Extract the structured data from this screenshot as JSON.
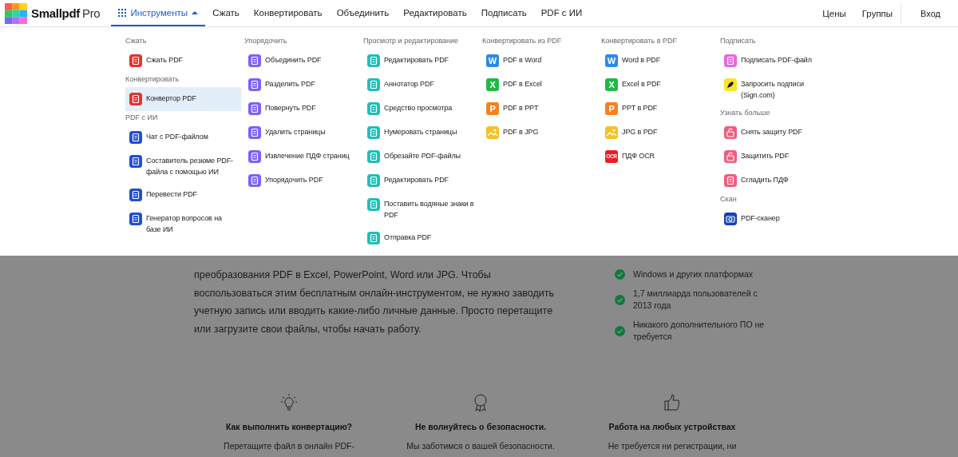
{
  "header": {
    "logo": {
      "name": "Smallpdf",
      "suffix": "Pro"
    },
    "nav": [
      {
        "label": "Инструменты",
        "selected": true,
        "kind": "menu"
      },
      {
        "label": "Сжать",
        "selected": false,
        "kind": "link"
      },
      {
        "label": "Конвертировать",
        "selected": false,
        "kind": "link"
      },
      {
        "label": "Объединить",
        "selected": false,
        "kind": "link"
      },
      {
        "label": "Редактировать",
        "selected": false,
        "kind": "link"
      },
      {
        "label": "Подписать",
        "selected": false,
        "kind": "link"
      },
      {
        "label": "PDF с ИИ",
        "selected": false,
        "kind": "link"
      }
    ],
    "right": [
      "Цены",
      "Группы"
    ],
    "login": "Вход"
  },
  "menu": {
    "columns": [
      {
        "groups": [
          {
            "heading": "Сжать",
            "items": [
              {
                "label": "Сжать PDF",
                "color": "#e5322d",
                "kind": "doc",
                "selected": false
              }
            ]
          },
          {
            "heading": "Конвертировать",
            "items": [
              {
                "label": "Конвертор PDF",
                "color": "#e5322d",
                "kind": "doc",
                "selected": true
              }
            ]
          },
          {
            "heading": "PDF с ИИ",
            "items": [
              {
                "label": "Чат с PDF-файлом",
                "color": "#1f4fd6",
                "kind": "doc",
                "selected": false
              },
              {
                "label": "Составитель резюме PDF-файла с помощью ИИ",
                "color": "#1f4fd6",
                "kind": "doc",
                "selected": false
              },
              {
                "label": "Перевести PDF",
                "color": "#1f4fd6",
                "kind": "doc",
                "selected": false
              },
              {
                "label": "Генератор вопросов на базе ИИ",
                "color": "#1f4fd6",
                "kind": "doc",
                "selected": false
              }
            ]
          }
        ]
      },
      {
        "groups": [
          {
            "heading": "Упорядочить",
            "items": [
              {
                "label": "Объединить PDF",
                "color": "#7b61ff",
                "kind": "doc",
                "selected": false
              },
              {
                "label": "Разделить PDF",
                "color": "#7b61ff",
                "kind": "doc",
                "selected": false
              },
              {
                "label": "Повернуть PDF",
                "color": "#7b61ff",
                "kind": "doc",
                "selected": false
              },
              {
                "label": "Удалить страницы",
                "color": "#7b61ff",
                "kind": "doc",
                "selected": false
              },
              {
                "label": "Извлечение ПДФ страниц",
                "color": "#7b61ff",
                "kind": "doc",
                "selected": false
              },
              {
                "label": "Упорядочить PDF",
                "color": "#7b61ff",
                "kind": "doc",
                "selected": false
              }
            ]
          }
        ]
      },
      {
        "groups": [
          {
            "heading": "Просмотр и редактирование",
            "items": [
              {
                "label": "Редактировать PDF",
                "color": "#1fbfb8",
                "kind": "doc",
                "selected": false
              },
              {
                "label": "Аннотатор PDF",
                "color": "#1fbfb8",
                "kind": "doc",
                "selected": false
              },
              {
                "label": "Средство просмотра",
                "color": "#1fbfb8",
                "kind": "doc",
                "selected": false
              },
              {
                "label": "Нумеровать страницы",
                "color": "#1fbfb8",
                "kind": "doc",
                "selected": false
              },
              {
                "label": "Обрезайте PDF-файлы",
                "color": "#1fbfb8",
                "kind": "doc",
                "selected": false
              },
              {
                "label": "Редактировать PDF",
                "color": "#1fbfb8",
                "kind": "doc",
                "selected": false
              },
              {
                "label": "Поставить водяные знаки в PDF",
                "color": "#1fbfb8",
                "kind": "doc",
                "selected": false
              },
              {
                "label": "Отправка PDF",
                "color": "#1fbfb8",
                "kind": "doc",
                "selected": false
              }
            ]
          }
        ]
      },
      {
        "groups": [
          {
            "heading": "Конвертировать из PDF",
            "items": [
              {
                "label": "PDF в Word",
                "color": "#2b8ae6",
                "kind": "letter",
                "glyph": "W",
                "selected": false
              },
              {
                "label": "PDF в Excel",
                "color": "#1fb84a",
                "kind": "letter",
                "glyph": "X",
                "selected": false
              },
              {
                "label": "PDF в PPT",
                "color": "#f5811f",
                "kind": "letter",
                "glyph": "P",
                "selected": false
              },
              {
                "label": "PDF в JPG",
                "color": "#f6c026",
                "kind": "image",
                "selected": false
              }
            ]
          }
        ]
      },
      {
        "groups": [
          {
            "heading": "Конвертировать в PDF",
            "items": [
              {
                "label": "Word в PDF",
                "color": "#2b8ae6",
                "kind": "letter",
                "glyph": "W",
                "selected": false
              },
              {
                "label": "Excel в PDF",
                "color": "#1fb84a",
                "kind": "letter",
                "glyph": "X",
                "selected": false
              },
              {
                "label": "PPT в PDF",
                "color": "#f5811f",
                "kind": "letter",
                "glyph": "P",
                "selected": false
              },
              {
                "label": "JPG в PDF",
                "color": "#f6c026",
                "kind": "image",
                "selected": false
              },
              {
                "label": "ПДФ OCR",
                "color": "#ec1c24",
                "kind": "letter",
                "glyph": "OCR",
                "selected": false
              }
            ]
          }
        ]
      },
      {
        "groups": [
          {
            "heading": "Подписать",
            "items": [
              {
                "label": "Подписать PDF-файл",
                "color": "#e66ad9",
                "kind": "doc",
                "selected": false
              },
              {
                "label": "Запросить подписи (Sign.com)",
                "color": "#f7e526",
                "kind": "pen",
                "selected": false
              }
            ]
          },
          {
            "heading": "Узнать больше",
            "items": [
              {
                "label": "Снять защиту PDF",
                "color": "#ef5e7c",
                "kind": "lock",
                "selected": false
              },
              {
                "label": "Защитить PDF",
                "color": "#ef5e7c",
                "kind": "lock",
                "selected": false
              },
              {
                "label": "Сгладить ПДФ",
                "color": "#ef5e7c",
                "kind": "doc",
                "selected": false
              }
            ]
          },
          {
            "heading": "Скан",
            "items": [
              {
                "label": "PDF-сканер",
                "color": "#1341b8",
                "kind": "camera",
                "selected": false
              }
            ]
          }
        ]
      }
    ]
  },
  "intro": "преобразования PDF в Excel, PowerPoint, Word или JPG. Чтобы воспользоваться этим бесплатным онлайн-инструментом, не нужно заводить учетную запись или вводить какие-либо личные данные. Просто перетащите или загрузите свои файлы, чтобы начать работу.",
  "benefits": [
    "Windows и других платформах",
    "1,7 миллиарда пользователей с 2013 года",
    "Никакого дополнительного ПО не требуется"
  ],
  "features": [
    {
      "kind": "bulb",
      "title": "Как выполнить конвертацию?",
      "text": "Перетащите файл в онлайн PDF-"
    },
    {
      "kind": "award",
      "title": "Не волнуйтесь о безопасности.",
      "text": "Мы заботимся о вашей безопасности."
    },
    {
      "kind": "thumb",
      "title": "Работа на любых устройствах",
      "text": "Не требуется ни регистрации, ни"
    }
  ]
}
